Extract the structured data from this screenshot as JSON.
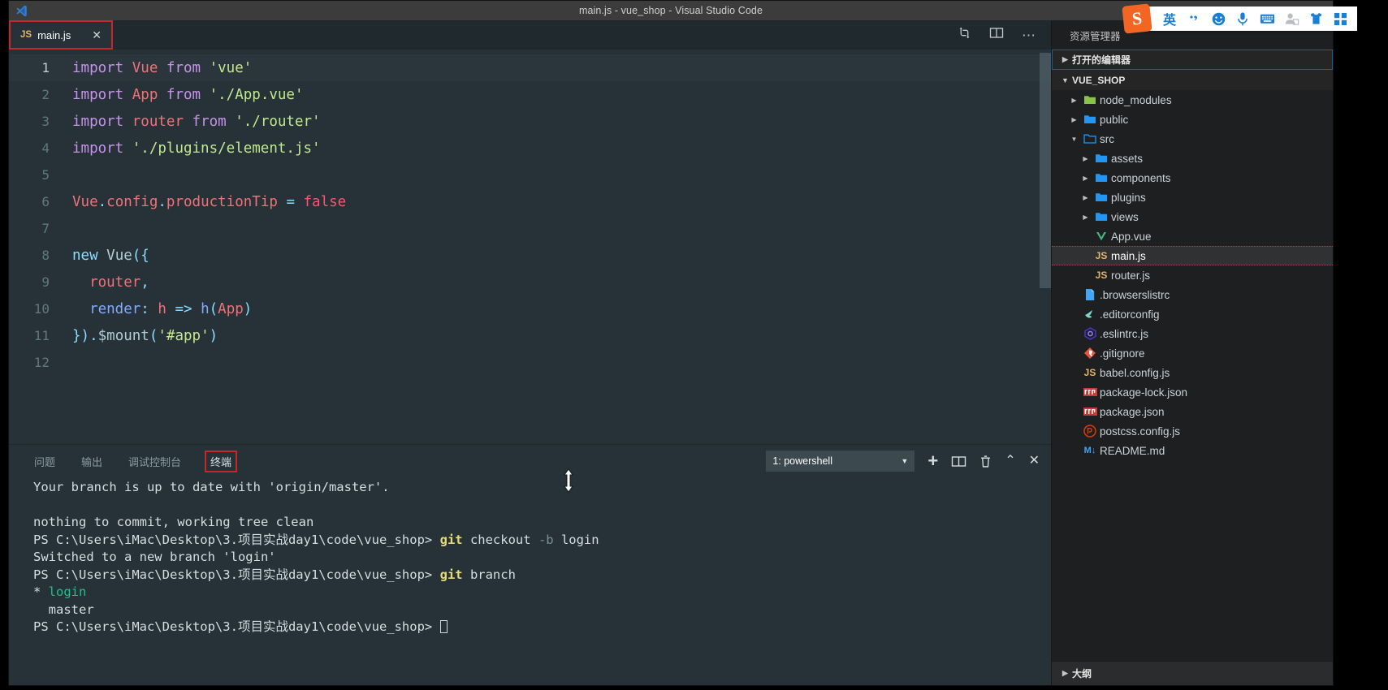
{
  "window": {
    "title": "main.js - vue_shop - Visual Studio Code",
    "minimize": "—",
    "maximize": "❐",
    "close": "✕"
  },
  "tabs": [
    {
      "icon": "js-file-icon",
      "badge": "JS",
      "label": "main.js",
      "close": "✕"
    }
  ],
  "editor_actions": {
    "compare": "split-compare-icon",
    "split": "split-editor-icon",
    "more": "⋯"
  },
  "code": {
    "lines": [
      {
        "num": "1",
        "tokens": [
          {
            "t": "import ",
            "c": "kw"
          },
          {
            "t": "Vue ",
            "c": "var"
          },
          {
            "t": "from ",
            "c": "kw"
          },
          {
            "t": "'vue'",
            "c": "str"
          }
        ]
      },
      {
        "num": "2",
        "tokens": [
          {
            "t": "import ",
            "c": "kw"
          },
          {
            "t": "App ",
            "c": "var"
          },
          {
            "t": "from ",
            "c": "kw"
          },
          {
            "t": "'./App.vue'",
            "c": "str"
          }
        ]
      },
      {
        "num": "3",
        "tokens": [
          {
            "t": "import ",
            "c": "kw"
          },
          {
            "t": "router ",
            "c": "var"
          },
          {
            "t": "from ",
            "c": "kw"
          },
          {
            "t": "'./router'",
            "c": "str"
          }
        ]
      },
      {
        "num": "4",
        "tokens": [
          {
            "t": "import ",
            "c": "kw"
          },
          {
            "t": "'./plugins/element.js'",
            "c": "str"
          }
        ]
      },
      {
        "num": "5",
        "tokens": []
      },
      {
        "num": "6",
        "tokens": [
          {
            "t": "Vue",
            "c": "var"
          },
          {
            "t": ".",
            "c": "punct"
          },
          {
            "t": "config",
            "c": "var"
          },
          {
            "t": ".",
            "c": "punct"
          },
          {
            "t": "productionTip ",
            "c": "var"
          },
          {
            "t": "= ",
            "c": "op"
          },
          {
            "t": "false",
            "c": "bool"
          }
        ]
      },
      {
        "num": "7",
        "tokens": []
      },
      {
        "num": "8",
        "tokens": [
          {
            "t": "new ",
            "c": "frm"
          },
          {
            "t": "Vue",
            "c": "plain"
          },
          {
            "t": "({",
            "c": "punct"
          }
        ]
      },
      {
        "num": "9",
        "tokens": [
          {
            "t": "  ",
            "c": "plain"
          },
          {
            "t": "router",
            "c": "var"
          },
          {
            "t": ",",
            "c": "punct"
          }
        ]
      },
      {
        "num": "10",
        "tokens": [
          {
            "t": "  ",
            "c": "plain"
          },
          {
            "t": "render",
            "c": "prop"
          },
          {
            "t": ": ",
            "c": "punct"
          },
          {
            "t": "h ",
            "c": "var"
          },
          {
            "t": "=> ",
            "c": "op"
          },
          {
            "t": "h",
            "c": "prop"
          },
          {
            "t": "(",
            "c": "punct"
          },
          {
            "t": "App",
            "c": "var"
          },
          {
            "t": ")",
            "c": "punct"
          }
        ]
      },
      {
        "num": "11",
        "tokens": [
          {
            "t": "})",
            "c": "punct"
          },
          {
            "t": ".",
            "c": "punct"
          },
          {
            "t": "$mount",
            "c": "plain"
          },
          {
            "t": "(",
            "c": "punct"
          },
          {
            "t": "'#app'",
            "c": "str"
          },
          {
            "t": ")",
            "c": "punct"
          }
        ]
      },
      {
        "num": "12",
        "tokens": []
      }
    ]
  },
  "panel": {
    "tabs": [
      {
        "label": "问题",
        "active": false
      },
      {
        "label": "输出",
        "active": false
      },
      {
        "label": "调试控制台",
        "active": false
      },
      {
        "label": "终端",
        "active": true
      }
    ],
    "terminal_select": "1: powershell",
    "select_caret": "▼",
    "actions": {
      "new": "+",
      "split": "split-terminal-icon",
      "kill": "trash-icon",
      "maximize": "⌃",
      "close": "✕"
    },
    "terminal_lines": [
      [
        {
          "t": "Your branch is up to date with 'origin/master'.",
          "c": "t-w"
        }
      ],
      [],
      [
        {
          "t": "nothing to commit, working tree clean",
          "c": "t-w"
        }
      ],
      [
        {
          "t": "PS C:\\Users\\iMac\\Desktop\\3.项目实战day1\\code\\vue_shop> ",
          "c": "t-w"
        },
        {
          "t": "git",
          "c": "t-y"
        },
        {
          "t": " checkout ",
          "c": "t-w"
        },
        {
          "t": "-b",
          "c": "t-d"
        },
        {
          "t": " login",
          "c": "t-w"
        }
      ],
      [
        {
          "t": "Switched to a new branch 'login'",
          "c": "t-w"
        }
      ],
      [
        {
          "t": "PS C:\\Users\\iMac\\Desktop\\3.项目实战day1\\code\\vue_shop> ",
          "c": "t-w"
        },
        {
          "t": "git",
          "c": "t-y"
        },
        {
          "t": " branch",
          "c": "t-w"
        }
      ],
      [
        {
          "t": "* ",
          "c": "t-w"
        },
        {
          "t": "login",
          "c": "t-g"
        }
      ],
      [
        {
          "t": "  master",
          "c": "t-w"
        }
      ],
      [
        {
          "t": "PS C:\\Users\\iMac\\Desktop\\3.项目实战day1\\code\\vue_shop> ",
          "c": "t-w"
        },
        {
          "t": "█",
          "c": "cursor"
        }
      ]
    ]
  },
  "sidebar": {
    "title": "资源管理器",
    "open_editors": "打开的编辑器",
    "project": "VUE_SHOP",
    "outline": "大纲",
    "tree": [
      {
        "label": "node_modules",
        "indent": 1,
        "twisty": "collapsed",
        "icon": "folder-node-icon",
        "type": "folder"
      },
      {
        "label": "public",
        "indent": 1,
        "twisty": "collapsed",
        "icon": "folder-icon",
        "type": "folder"
      },
      {
        "label": "src",
        "indent": 1,
        "twisty": "expanded",
        "icon": "folder-open-icon",
        "type": "folder"
      },
      {
        "label": "assets",
        "indent": 2,
        "twisty": "collapsed",
        "icon": "folder-icon",
        "type": "folder"
      },
      {
        "label": "components",
        "indent": 2,
        "twisty": "collapsed",
        "icon": "folder-icon",
        "type": "folder"
      },
      {
        "label": "plugins",
        "indent": 2,
        "twisty": "collapsed",
        "icon": "folder-icon",
        "type": "folder"
      },
      {
        "label": "views",
        "indent": 2,
        "twisty": "collapsed",
        "icon": "folder-icon",
        "type": "folder"
      },
      {
        "label": "App.vue",
        "indent": 2,
        "twisty": "none",
        "icon": "vue-file-icon",
        "type": "file"
      },
      {
        "label": "main.js",
        "indent": 2,
        "twisty": "none",
        "icon": "js-file-icon",
        "type": "file",
        "selected": true
      },
      {
        "label": "router.js",
        "indent": 2,
        "twisty": "none",
        "icon": "js-file-icon",
        "type": "file"
      },
      {
        "label": ".browserslistrc",
        "indent": 1,
        "twisty": "none",
        "icon": "text-file-icon",
        "type": "file"
      },
      {
        "label": ".editorconfig",
        "indent": 1,
        "twisty": "none",
        "icon": "editorconfig-icon",
        "type": "file"
      },
      {
        "label": ".eslintrc.js",
        "indent": 1,
        "twisty": "none",
        "icon": "eslint-icon",
        "type": "file"
      },
      {
        "label": ".gitignore",
        "indent": 1,
        "twisty": "none",
        "icon": "git-icon",
        "type": "file"
      },
      {
        "label": "babel.config.js",
        "indent": 1,
        "twisty": "none",
        "icon": "js-file-icon",
        "type": "file"
      },
      {
        "label": "package-lock.json",
        "indent": 1,
        "twisty": "none",
        "icon": "npm-icon",
        "type": "file"
      },
      {
        "label": "package.json",
        "indent": 1,
        "twisty": "none",
        "icon": "npm-icon",
        "type": "file"
      },
      {
        "label": "postcss.config.js",
        "indent": 1,
        "twisty": "none",
        "icon": "postcss-icon",
        "type": "file"
      },
      {
        "label": "README.md",
        "indent": 1,
        "twisty": "none",
        "icon": "markdown-icon",
        "type": "file"
      }
    ]
  },
  "ime": {
    "logo": "S",
    "items": [
      {
        "name": "language-mode-icon",
        "glyph": "英"
      },
      {
        "name": "punctuation-icon",
        "glyph": "’,"
      },
      {
        "name": "emoji-icon",
        "glyph": "☺"
      },
      {
        "name": "voice-input-icon",
        "glyph": "⬤"
      },
      {
        "name": "soft-keyboard-icon",
        "glyph": "⌨"
      },
      {
        "name": "user-icon",
        "glyph": "☰"
      },
      {
        "name": "skin-icon",
        "glyph": "♢"
      },
      {
        "name": "toolbox-icon",
        "glyph": "☰"
      }
    ]
  },
  "colors": {
    "editor_bg": "#263238",
    "sidebar_bg": "#1d1f21",
    "accent_red": "#c62828",
    "title_bg": "#3c3c3c",
    "js_yellow": "#e5b567",
    "vue_green": "#41b883",
    "ime_blue": "#1a7fd4",
    "ime_orange": "#f26522"
  }
}
